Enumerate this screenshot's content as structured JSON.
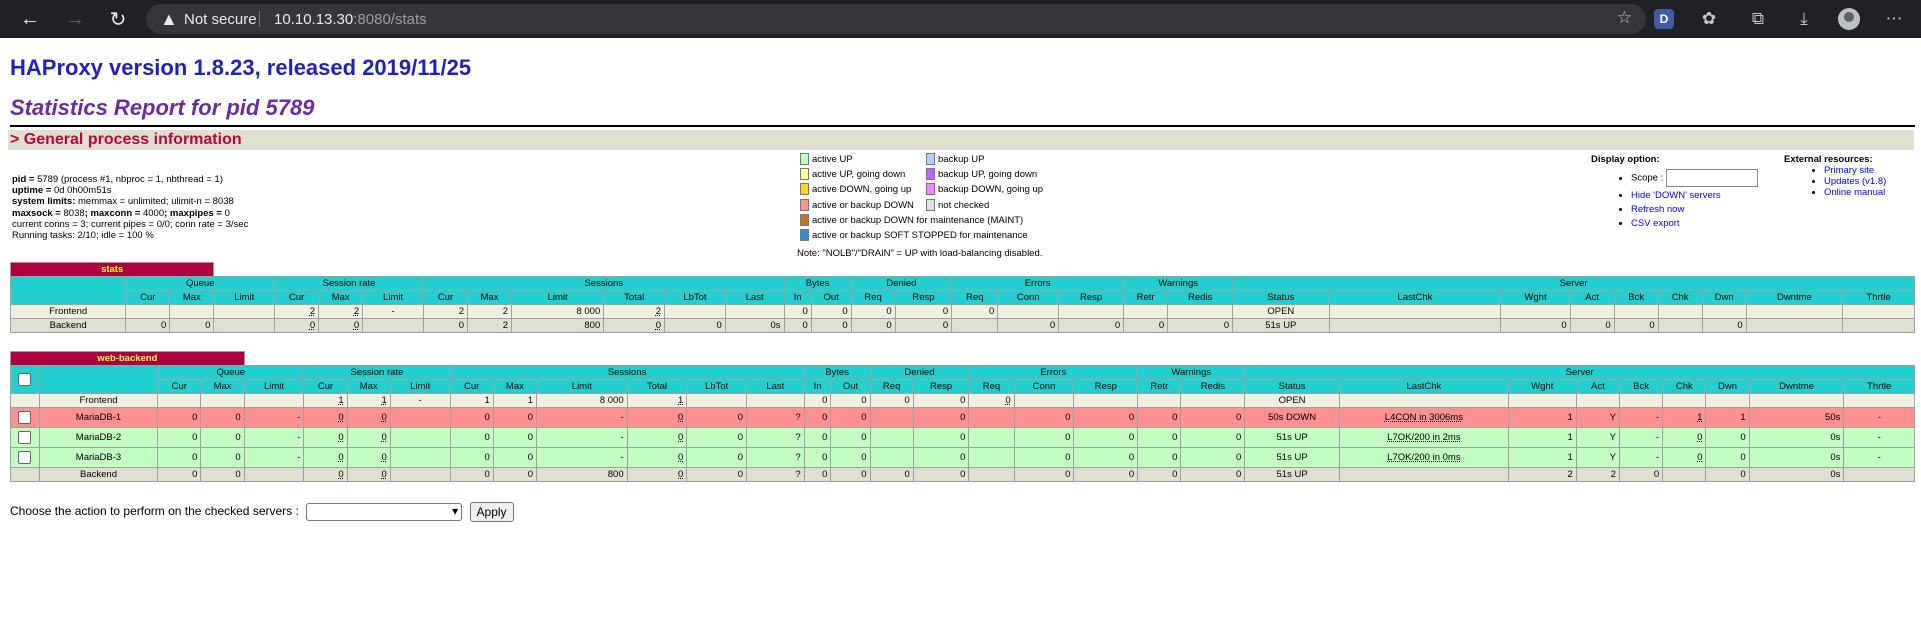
{
  "browser": {
    "not_secure": "Not secure",
    "url_host": "10.10.13.30",
    "url_rest": ":8080/stats",
    "ext_d": "D"
  },
  "title": "HAProxy version 1.8.23, released 2019/11/25",
  "subtitle": "Statistics Report for pid 5789",
  "gpi_title": "> General process information",
  "proc": {
    "l1a": "pid = ",
    "l1b": "5789 (process #1, nbproc = 1, nbthread = 1)",
    "l2a": "uptime = ",
    "l2b": "0d 0h00m51s",
    "l3a": "system limits:",
    "l3b": " memmax = unlimited; ulimit-n = ",
    "l3c": "8038",
    "l4a": "maxsock = ",
    "l4b": "8038",
    "l4c": "; maxconn = ",
    "l4d": "4000",
    "l4e": "; maxpipes = ",
    "l4f": "0",
    "l5": "current conns = 3; current pipes = 0/0; conn rate = 3/sec",
    "l6": "Running tasks: 2/10; idle = 100 %"
  },
  "legend": [
    {
      "label": "active UP",
      "color": "#c0ffc0"
    },
    {
      "label": "active UP, going down",
      "color": "#ffffa0"
    },
    {
      "label": "active DOWN, going up",
      "color": "#ffd020"
    },
    {
      "label": "active or backup DOWN",
      "color": "#ff9090"
    },
    {
      "label": "active or backup DOWN for maintenance (MAINT)",
      "color": "#c07820"
    },
    {
      "label": "active or backup SOFT STOPPED for maintenance",
      "color": "#3090d0"
    },
    {
      "label": "backup UP",
      "color": "#b0d0ff"
    },
    {
      "label": "backup UP, going down",
      "color": "#c060ff"
    },
    {
      "label": "backup DOWN, going up",
      "color": "#ff80ff"
    },
    {
      "label": "not checked",
      "color": "#e0e0e0"
    }
  ],
  "nolb": "Note: \"NOLB\"/\"DRAIN\" = UP with load-balancing disabled.",
  "display": {
    "title": "Display option:",
    "scope": "Scope :",
    "hide": "Hide 'DOWN' servers",
    "refresh": "Refresh now",
    "csv": "CSV export"
  },
  "external": {
    "title": "External resources:",
    "primary": "Primary site",
    "updates": "Updates (v1.8)",
    "manual": "Online manual"
  },
  "groups": [
    "Queue",
    "Session rate",
    "Sessions",
    "Bytes",
    "Denied",
    "Errors",
    "Warnings",
    "Server"
  ],
  "cols": [
    "Cur",
    "Max",
    "Limit",
    "Cur",
    "Max",
    "Limit",
    "Cur",
    "Max",
    "Limit",
    "Total",
    "LbTot",
    "Last",
    "In",
    "Out",
    "Req",
    "Resp",
    "Req",
    "Conn",
    "Resp",
    "Retr",
    "Redis",
    "Status",
    "LastChk",
    "Wght",
    "Act",
    "Bck",
    "Chk",
    "Dwn",
    "Dwntme",
    "Thrtle"
  ],
  "stats": {
    "name": "stats",
    "rows": [
      {
        "cls": "fe",
        "cells": [
          "Frontend",
          "",
          "",
          "",
          "2",
          "2",
          "-",
          "2",
          "2",
          "8 000",
          "2",
          "",
          "",
          "0",
          "0",
          "0",
          "0",
          "0",
          "",
          "",
          "",
          "",
          "OPEN",
          "",
          "",
          "",
          "",
          "",
          "",
          "",
          ""
        ]
      },
      {
        "cls": "be",
        "cells": [
          "Backend",
          "0",
          "0",
          "",
          "0",
          "0",
          "",
          "0",
          "2",
          "800",
          "0",
          "0",
          "0s",
          "0",
          "0",
          "0",
          "0",
          "",
          "0",
          "0",
          "0",
          "0",
          "51s UP",
          "",
          "0",
          "0",
          "0",
          "",
          "0",
          "",
          ""
        ]
      }
    ]
  },
  "web": {
    "name": "web-backend",
    "rows": [
      {
        "cls": "fe",
        "cb": false,
        "cells": [
          "Frontend",
          "",
          "",
          "",
          "1",
          "1",
          "-",
          "1",
          "1",
          "8 000",
          "1",
          "",
          "",
          "0",
          "0",
          "0",
          "0",
          "0",
          "",
          "",
          "",
          "",
          "OPEN",
          "",
          "",
          "",
          "",
          "",
          "",
          "",
          ""
        ]
      },
      {
        "cls": "down",
        "cb": true,
        "cells": [
          "MariaDB-1",
          "0",
          "0",
          "-",
          "0",
          "0",
          "",
          "0",
          "0",
          "-",
          "0",
          "0",
          "?",
          "0",
          "0",
          "",
          "0",
          "",
          "0",
          "0",
          "0",
          "0",
          "50s DOWN",
          "L4CON in 3006ms",
          "1",
          "Y",
          "-",
          "1",
          "1",
          "50s",
          "-"
        ]
      },
      {
        "cls": "up",
        "cb": true,
        "cells": [
          "MariaDB-2",
          "0",
          "0",
          "-",
          "0",
          "0",
          "",
          "0",
          "0",
          "-",
          "0",
          "0",
          "?",
          "0",
          "0",
          "",
          "0",
          "",
          "0",
          "0",
          "0",
          "0",
          "51s UP",
          "L7OK/200 in 2ms",
          "1",
          "Y",
          "-",
          "0",
          "0",
          "0s",
          "-"
        ]
      },
      {
        "cls": "up",
        "cb": true,
        "cells": [
          "MariaDB-3",
          "0",
          "0",
          "-",
          "0",
          "0",
          "",
          "0",
          "0",
          "-",
          "0",
          "0",
          "?",
          "0",
          "0",
          "",
          "0",
          "",
          "0",
          "0",
          "0",
          "0",
          "51s UP",
          "L7OK/200 in 0ms",
          "1",
          "Y",
          "-",
          "0",
          "0",
          "0s",
          "-"
        ]
      },
      {
        "cls": "be",
        "cb": false,
        "cells": [
          "Backend",
          "0",
          "0",
          "",
          "0",
          "0",
          "",
          "0",
          "0",
          "800",
          "0",
          "0",
          "?",
          "0",
          "0",
          "0",
          "0",
          "",
          "0",
          "0",
          "0",
          "0",
          "51s UP",
          "",
          "2",
          "2",
          "0",
          "",
          "0",
          "0s",
          ""
        ]
      }
    ]
  },
  "action": {
    "label": "Choose the action to perform on the checked servers :",
    "apply": "Apply"
  }
}
